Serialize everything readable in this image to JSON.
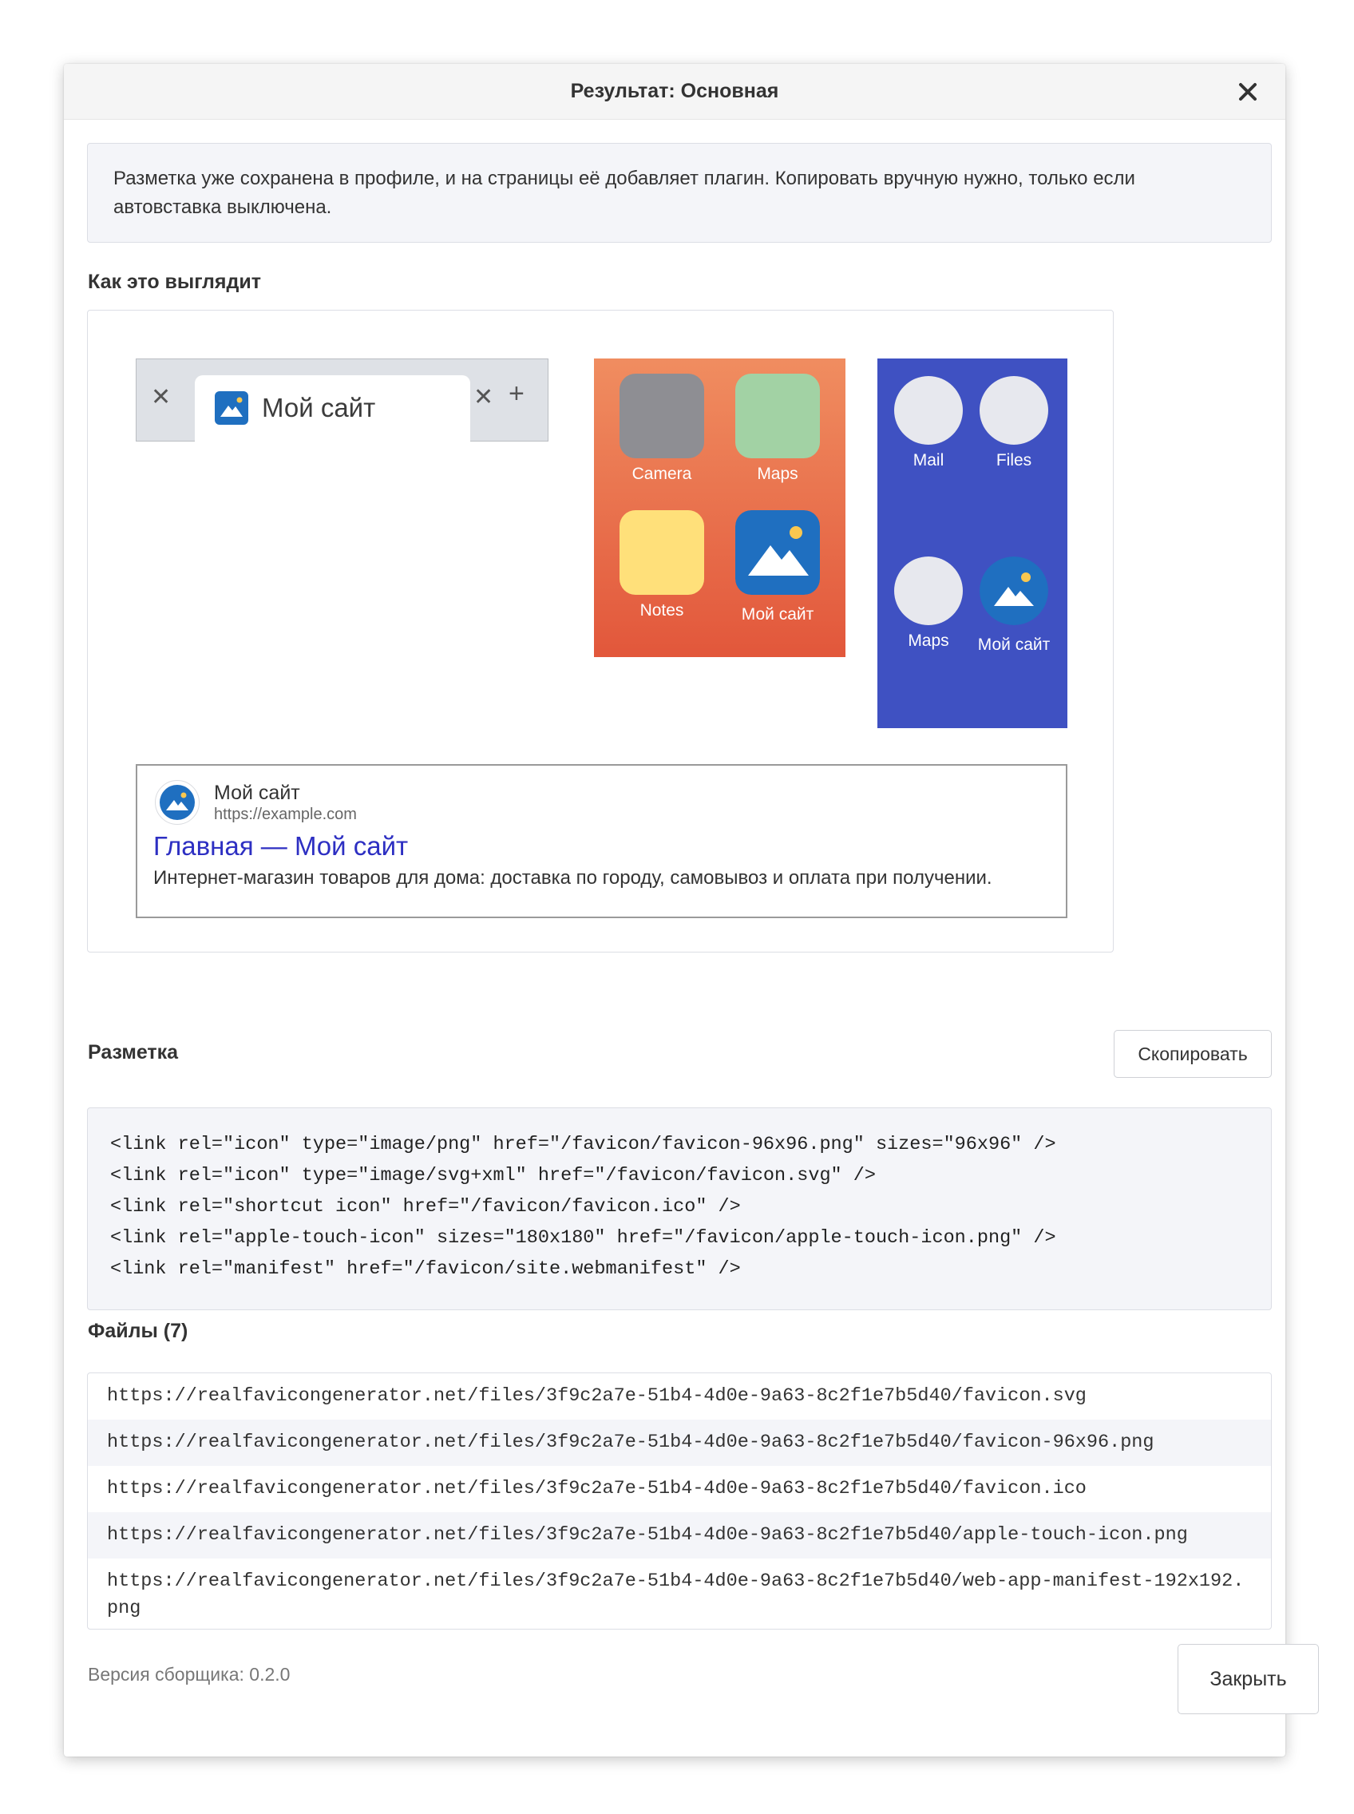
{
  "dialog": {
    "title": "Результат: Основная",
    "close_icon": "close-icon"
  },
  "notice": "Разметка уже сохранена в профиле, и на страницы её добавляет плагин. Копировать вручную нужно, только если автовставка выключена.",
  "preview": {
    "title": "Как это выглядит",
    "browser_tab": {
      "label": "Мой сайт"
    },
    "ios_apps": [
      {
        "label": "Camera",
        "color": "#8e8e93"
      },
      {
        "label": "Maps",
        "color": "#a2d2a4"
      },
      {
        "label": "Notes",
        "color": "#ffe07a"
      },
      {
        "label": "Мой сайт",
        "color": "#1f6fc0"
      }
    ],
    "android_apps": [
      {
        "label": "Mail"
      },
      {
        "label": "Files"
      },
      {
        "label": "Maps"
      },
      {
        "label": "Мой сайт"
      }
    ],
    "search_result": {
      "site_name": "Мой сайт",
      "url": "https://example.com",
      "title": "Главная — Мой сайт",
      "description": "Интернет-магазин товаров для дома: доставка по городу, самовывоз и оплата при получении."
    }
  },
  "markup": {
    "title": "Разметка",
    "copy_label": "Скопировать",
    "code": "<link rel=\"icon\" type=\"image/png\" href=\"/favicon/favicon-96x96.png\" sizes=\"96x96\" />\n<link rel=\"icon\" type=\"image/svg+xml\" href=\"/favicon/favicon.svg\" />\n<link rel=\"shortcut icon\" href=\"/favicon/favicon.ico\" />\n<link rel=\"apple-touch-icon\" sizes=\"180x180\" href=\"/favicon/apple-touch-icon.png\" />\n<link rel=\"manifest\" href=\"/favicon/site.webmanifest\" />"
  },
  "files": {
    "title": "Файлы (7)",
    "items": [
      "https://realfavicongenerator.net/files/3f9c2a7e-51b4-4d0e-9a63-8c2f1e7b5d40/favicon.svg",
      "https://realfavicongenerator.net/files/3f9c2a7e-51b4-4d0e-9a63-8c2f1e7b5d40/favicon-96x96.png",
      "https://realfavicongenerator.net/files/3f9c2a7e-51b4-4d0e-9a63-8c2f1e7b5d40/favicon.ico",
      "https://realfavicongenerator.net/files/3f9c2a7e-51b4-4d0e-9a63-8c2f1e7b5d40/apple-touch-icon.png",
      "https://realfavicongenerator.net/files/3f9c2a7e-51b4-4d0e-9a63-8c2f1e7b5d40/web-app-manifest-192x192.png"
    ]
  },
  "version": "Версия сборщика: 0.2.0",
  "footer": {
    "close_label": "Закрыть"
  },
  "colors": {
    "favicon_bg": "#1f6fc0",
    "favicon_sun": "#f9c74f",
    "ios_gradient_top": "#f08d60",
    "ios_gradient_bottom": "#e2573b",
    "android_bg": "#3f51c2",
    "serp_link": "#2d2fc2"
  }
}
